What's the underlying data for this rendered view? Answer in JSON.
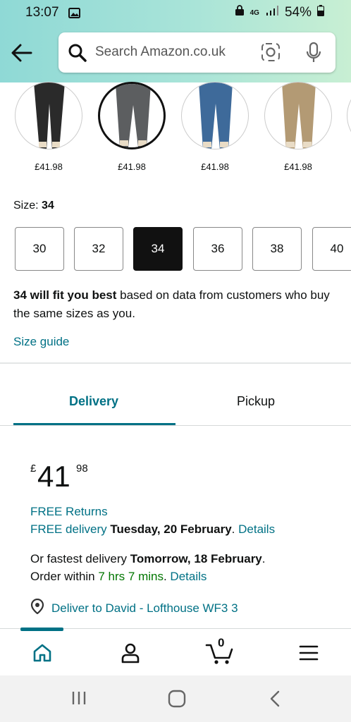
{
  "status": {
    "time": "13:07",
    "network": "4G",
    "battery": "54%"
  },
  "search": {
    "placeholder": "Search Amazon.co.uk"
  },
  "swatches": [
    {
      "color": "#2a2a2a",
      "price": "£41.98"
    },
    {
      "color": "#5c5e60",
      "price": "£41.98"
    },
    {
      "color": "#3e6a9a",
      "price": "£41.98"
    },
    {
      "color": "#b39a74",
      "price": "£41.98"
    }
  ],
  "size": {
    "label": "Size: ",
    "selected": "34",
    "options": [
      "30",
      "32",
      "34",
      "36",
      "38",
      "40"
    ],
    "fit_bold": "34 will fit you best",
    "fit_rest": " based on data from customers who buy the same sizes as you.",
    "guide": "Size guide"
  },
  "tabs": {
    "delivery": "Delivery",
    "pickup": "Pickup"
  },
  "price": {
    "currency": "£",
    "whole": "41",
    "fraction": "98"
  },
  "delivery": {
    "free_returns": "FREE Returns",
    "free_delivery": "FREE delivery",
    "free_date": "Tuesday, 20 February",
    "details": "Details",
    "fastest_prefix": "Or fastest delivery ",
    "fastest_date": "Tomorrow, 18 February",
    "order_within": "Order within ",
    "countdown": "7 hrs 7 mins",
    "deliver_to": "Deliver to David - Lofthouse WF3 3"
  },
  "nav": {
    "cart_count": "0"
  },
  "colors": {
    "teal": "#007185",
    "green": "#007600",
    "header_start": "#8fd9d6",
    "header_end": "#c8efd3"
  }
}
